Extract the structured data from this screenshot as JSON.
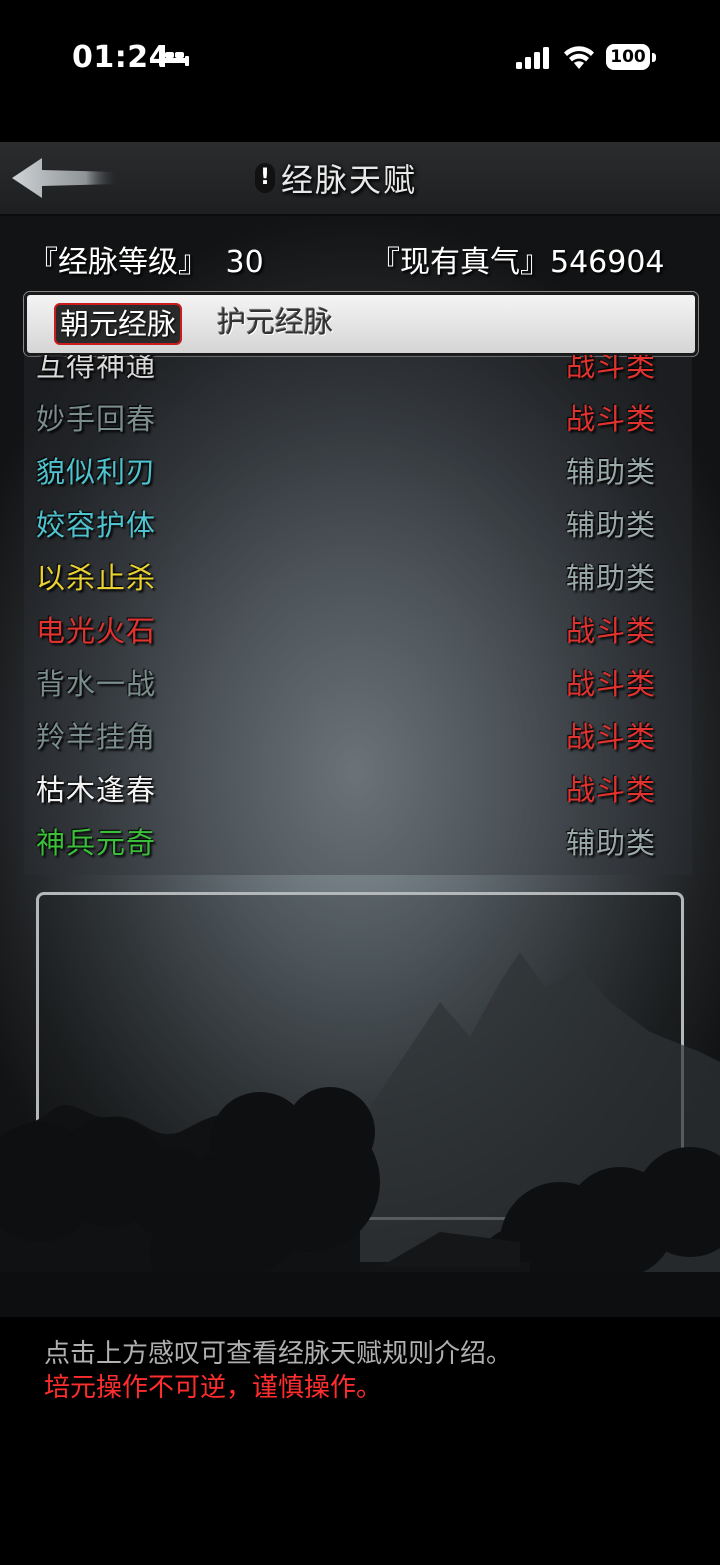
{
  "status_bar": {
    "time": "01:24",
    "battery": "100"
  },
  "header": {
    "title": "经脉天赋",
    "info_marker": "!"
  },
  "stats": {
    "level_label": "『经脉等级』",
    "level_value": "30",
    "qi_label": "『现有真气』",
    "qi_value": "546904"
  },
  "tabs": [
    {
      "label": "朝元经脉",
      "active": true
    },
    {
      "label": "护元经脉",
      "active": false
    }
  ],
  "talents": [
    {
      "name": "互得神通",
      "category": "战斗类",
      "name_color": "#d9d9d9",
      "category_color": "#e0322f"
    },
    {
      "name": "妙手回春",
      "category": "战斗类",
      "name_color": "#7b8c8c",
      "category_color": "#e0322f"
    },
    {
      "name": "貌似利刃",
      "category": "辅助类",
      "name_color": "#4ec3cf",
      "category_color": "#9aa8a8"
    },
    {
      "name": "姣容护体",
      "category": "辅助类",
      "name_color": "#4ec3cf",
      "category_color": "#9aa8a8"
    },
    {
      "name": "以杀止杀",
      "category": "辅助类",
      "name_color": "#e8d130",
      "category_color": "#9aa8a8"
    },
    {
      "name": "电光火石",
      "category": "战斗类",
      "name_color": "#e0322f",
      "category_color": "#e0322f"
    },
    {
      "name": "背水一战",
      "category": "战斗类",
      "name_color": "#7b8c8c",
      "category_color": "#e0322f"
    },
    {
      "name": "羚羊挂角",
      "category": "战斗类",
      "name_color": "#7b8c8c",
      "category_color": "#e0322f"
    },
    {
      "name": "枯木逢春",
      "category": "战斗类",
      "name_color": "#f2f2f2",
      "category_color": "#e0322f"
    },
    {
      "name": "神兵元奇",
      "category": "辅助类",
      "name_color": "#3bbf3b",
      "category_color": "#9aa8a8"
    }
  ],
  "notes": {
    "line1": "点击上方感叹可查看经脉天赋规则介绍。",
    "line2": "培元操作不可逆，谨慎操作。"
  },
  "icons": {
    "back": "back-arrow-icon",
    "bed": "bed-icon",
    "signal": "cellular-signal-icon",
    "wifi": "wifi-icon",
    "battery": "battery-icon"
  }
}
